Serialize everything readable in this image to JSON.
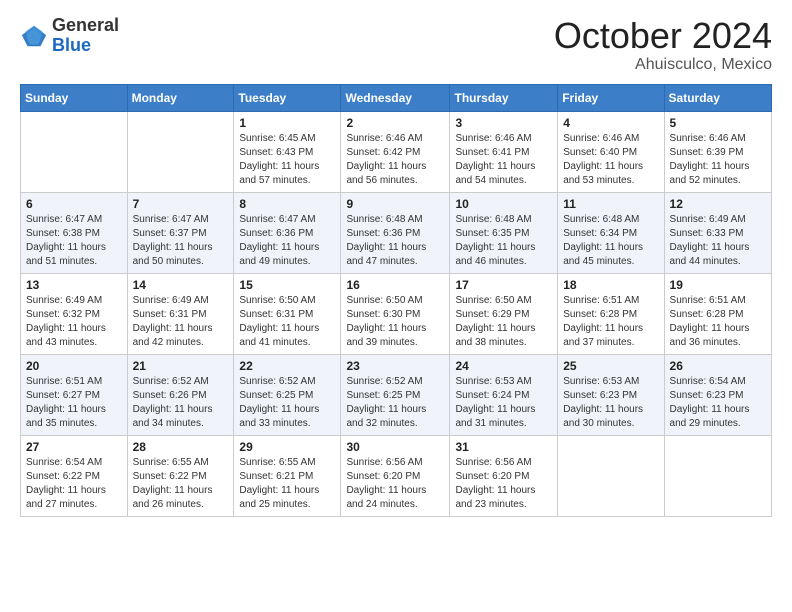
{
  "logo": {
    "general": "General",
    "blue": "Blue"
  },
  "header": {
    "month": "October 2024",
    "location": "Ahuisculco, Mexico"
  },
  "weekdays": [
    "Sunday",
    "Monday",
    "Tuesday",
    "Wednesday",
    "Thursday",
    "Friday",
    "Saturday"
  ],
  "weeks": [
    [
      {
        "day": "",
        "info": ""
      },
      {
        "day": "",
        "info": ""
      },
      {
        "day": "1",
        "info": "Sunrise: 6:45 AM\nSunset: 6:43 PM\nDaylight: 11 hours and 57 minutes."
      },
      {
        "day": "2",
        "info": "Sunrise: 6:46 AM\nSunset: 6:42 PM\nDaylight: 11 hours and 56 minutes."
      },
      {
        "day": "3",
        "info": "Sunrise: 6:46 AM\nSunset: 6:41 PM\nDaylight: 11 hours and 54 minutes."
      },
      {
        "day": "4",
        "info": "Sunrise: 6:46 AM\nSunset: 6:40 PM\nDaylight: 11 hours and 53 minutes."
      },
      {
        "day": "5",
        "info": "Sunrise: 6:46 AM\nSunset: 6:39 PM\nDaylight: 11 hours and 52 minutes."
      }
    ],
    [
      {
        "day": "6",
        "info": "Sunrise: 6:47 AM\nSunset: 6:38 PM\nDaylight: 11 hours and 51 minutes."
      },
      {
        "day": "7",
        "info": "Sunrise: 6:47 AM\nSunset: 6:37 PM\nDaylight: 11 hours and 50 minutes."
      },
      {
        "day": "8",
        "info": "Sunrise: 6:47 AM\nSunset: 6:36 PM\nDaylight: 11 hours and 49 minutes."
      },
      {
        "day": "9",
        "info": "Sunrise: 6:48 AM\nSunset: 6:36 PM\nDaylight: 11 hours and 47 minutes."
      },
      {
        "day": "10",
        "info": "Sunrise: 6:48 AM\nSunset: 6:35 PM\nDaylight: 11 hours and 46 minutes."
      },
      {
        "day": "11",
        "info": "Sunrise: 6:48 AM\nSunset: 6:34 PM\nDaylight: 11 hours and 45 minutes."
      },
      {
        "day": "12",
        "info": "Sunrise: 6:49 AM\nSunset: 6:33 PM\nDaylight: 11 hours and 44 minutes."
      }
    ],
    [
      {
        "day": "13",
        "info": "Sunrise: 6:49 AM\nSunset: 6:32 PM\nDaylight: 11 hours and 43 minutes."
      },
      {
        "day": "14",
        "info": "Sunrise: 6:49 AM\nSunset: 6:31 PM\nDaylight: 11 hours and 42 minutes."
      },
      {
        "day": "15",
        "info": "Sunrise: 6:50 AM\nSunset: 6:31 PM\nDaylight: 11 hours and 41 minutes."
      },
      {
        "day": "16",
        "info": "Sunrise: 6:50 AM\nSunset: 6:30 PM\nDaylight: 11 hours and 39 minutes."
      },
      {
        "day": "17",
        "info": "Sunrise: 6:50 AM\nSunset: 6:29 PM\nDaylight: 11 hours and 38 minutes."
      },
      {
        "day": "18",
        "info": "Sunrise: 6:51 AM\nSunset: 6:28 PM\nDaylight: 11 hours and 37 minutes."
      },
      {
        "day": "19",
        "info": "Sunrise: 6:51 AM\nSunset: 6:28 PM\nDaylight: 11 hours and 36 minutes."
      }
    ],
    [
      {
        "day": "20",
        "info": "Sunrise: 6:51 AM\nSunset: 6:27 PM\nDaylight: 11 hours and 35 minutes."
      },
      {
        "day": "21",
        "info": "Sunrise: 6:52 AM\nSunset: 6:26 PM\nDaylight: 11 hours and 34 minutes."
      },
      {
        "day": "22",
        "info": "Sunrise: 6:52 AM\nSunset: 6:25 PM\nDaylight: 11 hours and 33 minutes."
      },
      {
        "day": "23",
        "info": "Sunrise: 6:52 AM\nSunset: 6:25 PM\nDaylight: 11 hours and 32 minutes."
      },
      {
        "day": "24",
        "info": "Sunrise: 6:53 AM\nSunset: 6:24 PM\nDaylight: 11 hours and 31 minutes."
      },
      {
        "day": "25",
        "info": "Sunrise: 6:53 AM\nSunset: 6:23 PM\nDaylight: 11 hours and 30 minutes."
      },
      {
        "day": "26",
        "info": "Sunrise: 6:54 AM\nSunset: 6:23 PM\nDaylight: 11 hours and 29 minutes."
      }
    ],
    [
      {
        "day": "27",
        "info": "Sunrise: 6:54 AM\nSunset: 6:22 PM\nDaylight: 11 hours and 27 minutes."
      },
      {
        "day": "28",
        "info": "Sunrise: 6:55 AM\nSunset: 6:22 PM\nDaylight: 11 hours and 26 minutes."
      },
      {
        "day": "29",
        "info": "Sunrise: 6:55 AM\nSunset: 6:21 PM\nDaylight: 11 hours and 25 minutes."
      },
      {
        "day": "30",
        "info": "Sunrise: 6:56 AM\nSunset: 6:20 PM\nDaylight: 11 hours and 24 minutes."
      },
      {
        "day": "31",
        "info": "Sunrise: 6:56 AM\nSunset: 6:20 PM\nDaylight: 11 hours and 23 minutes."
      },
      {
        "day": "",
        "info": ""
      },
      {
        "day": "",
        "info": ""
      }
    ]
  ]
}
